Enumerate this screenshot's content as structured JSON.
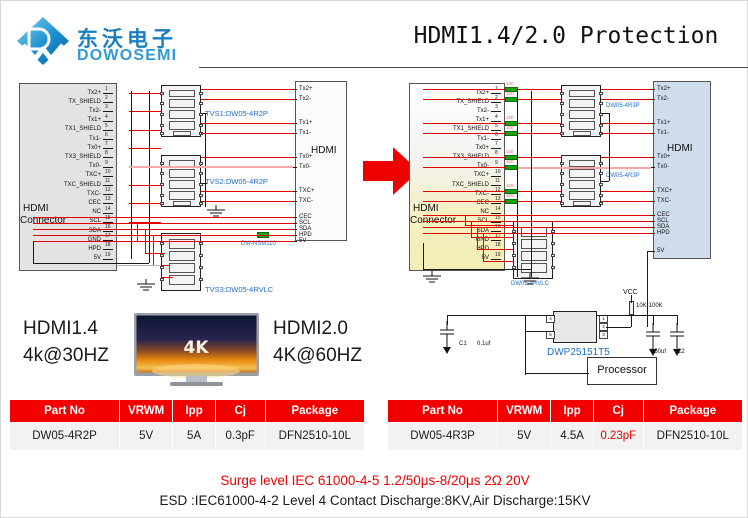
{
  "header": {
    "logo_cn": "东沃电子",
    "logo_en": "DOWOSEMI",
    "title": "HDMI1.4/2.0  Protection"
  },
  "left_circuit": {
    "connector_title_1": "HDMI",
    "connector_title_2": "Connector",
    "hdmi_label": "HDMI",
    "pins": [
      {
        "num": "1",
        "name": "Tx2+"
      },
      {
        "num": "2",
        "name": "TX_SHIELD"
      },
      {
        "num": "3",
        "name": "Tx2-"
      },
      {
        "num": "4",
        "name": "Tx1+"
      },
      {
        "num": "5",
        "name": "TX1_SHIELD"
      },
      {
        "num": "6",
        "name": "Tx1-"
      },
      {
        "num": "7",
        "name": "Tx0+"
      },
      {
        "num": "8",
        "name": "TX3_SHIELD"
      },
      {
        "num": "9",
        "name": "Tx0-"
      },
      {
        "num": "10",
        "name": "TXC+"
      },
      {
        "num": "11",
        "name": "TXC_SHIELD"
      },
      {
        "num": "12",
        "name": "TXC-"
      },
      {
        "num": "13",
        "name": "CEC"
      },
      {
        "num": "14",
        "name": "NC"
      },
      {
        "num": "15",
        "name": "SCL"
      },
      {
        "num": "16",
        "name": "SDA"
      },
      {
        "num": "17",
        "name": "GND"
      },
      {
        "num": "18",
        "name": "HPD"
      },
      {
        "num": "19",
        "name": "5V"
      }
    ],
    "hdmi_pins": [
      "Tx2+",
      "Tx2-",
      "Tx1+",
      "Tx1-",
      "Tx0+",
      "Tx0-",
      "TXC+",
      "TXC-",
      "CEC",
      "SCL",
      "SDA",
      "HPD",
      "5V"
    ],
    "components": [
      {
        "ref": "TVS1:DW05-4R2P"
      },
      {
        "ref": "TVS2:DW05-4R2P"
      },
      {
        "ref": "TVS3:DW05-4RVLC"
      },
      {
        "ref": "DW-NSM110"
      }
    ]
  },
  "right_circuit": {
    "connector_title_1": "HDMI",
    "connector_title_2": "Connector",
    "hdmi_label": "HDMI",
    "pins": [
      {
        "num": "1",
        "name": "Tx2+"
      },
      {
        "num": "2",
        "name": "TX_SHIELD"
      },
      {
        "num": "3",
        "name": "Tx2-"
      },
      {
        "num": "4",
        "name": "Tx1+"
      },
      {
        "num": "5",
        "name": "TX1_SHIELD"
      },
      {
        "num": "6",
        "name": "Tx1-"
      },
      {
        "num": "7",
        "name": "Tx0+"
      },
      {
        "num": "8",
        "name": "TX3_SHIELD"
      },
      {
        "num": "9",
        "name": "Tx0-"
      },
      {
        "num": "10",
        "name": "TXC+"
      },
      {
        "num": "11",
        "name": "TXC_SHIELD"
      },
      {
        "num": "12",
        "name": "TXC-"
      },
      {
        "num": "13",
        "name": "CEC"
      },
      {
        "num": "14",
        "name": "NC"
      },
      {
        "num": "15",
        "name": "SCL"
      },
      {
        "num": "16",
        "name": "SDA"
      },
      {
        "num": "17",
        "name": "GND"
      },
      {
        "num": "18",
        "name": "HPD"
      },
      {
        "num": "19",
        "name": "5V"
      }
    ],
    "hdmi_pins": [
      "Tx2+",
      "Tx2-",
      "Tx1+",
      "Tx1-",
      "Tx0+",
      "Tx0-",
      "TXC+",
      "TXC-",
      "CEC",
      "SCL",
      "SDA",
      "HPD",
      "5V"
    ],
    "components": [
      {
        "ref": "DW05-4R3P"
      },
      {
        "ref": "DW05-4R3P"
      },
      {
        "ref": "DW05-4RVLC"
      },
      {
        "ref": "DWP25151T5"
      }
    ],
    "resistor_value": "100",
    "vcc_label": "VCC",
    "pullup_label": "10K-100K",
    "cap1_ref": "C1",
    "cap1_val": "0.1uf",
    "cap2_ref": "C2",
    "cap2_val": "150uf",
    "processor_label": "Processor",
    "ic_pins": [
      "1",
      "2",
      "3",
      "4",
      "5"
    ]
  },
  "middle": {
    "left_line1": "HDMI1.4",
    "left_line2": "4k@30HZ",
    "right_line1": "HDMI2.0",
    "right_line2": "4K@60HZ",
    "tv_badge": "4K"
  },
  "table_left": {
    "headers": [
      "Part No",
      "VRWM",
      "Ipp",
      "Cj",
      "Package"
    ],
    "row": [
      "DW05-4R2P",
      "5V",
      "5A",
      "0.3pF",
      "DFN2510-10L"
    ]
  },
  "table_right": {
    "headers": [
      "Part No",
      "VRWM",
      "Ipp",
      "Cj",
      "Package"
    ],
    "row": [
      "DW05-4R3P",
      "5V",
      "4.5A",
      "0.23pF",
      "DFN2510-10L"
    ]
  },
  "footer": {
    "surge": "Surge level IEC 61000-4-5 1.2/50μs-8/20μs 2Ω  20V",
    "esd": "ESD :IEC61000-4-2 Level 4 Contact Discharge:8KV,Air Discharge:15KV"
  },
  "colors": {
    "brand_blue": "#2f9ad6",
    "table_header_red": "#f20000",
    "wire_red": "#e20000",
    "highlight_red": "#e20000"
  }
}
